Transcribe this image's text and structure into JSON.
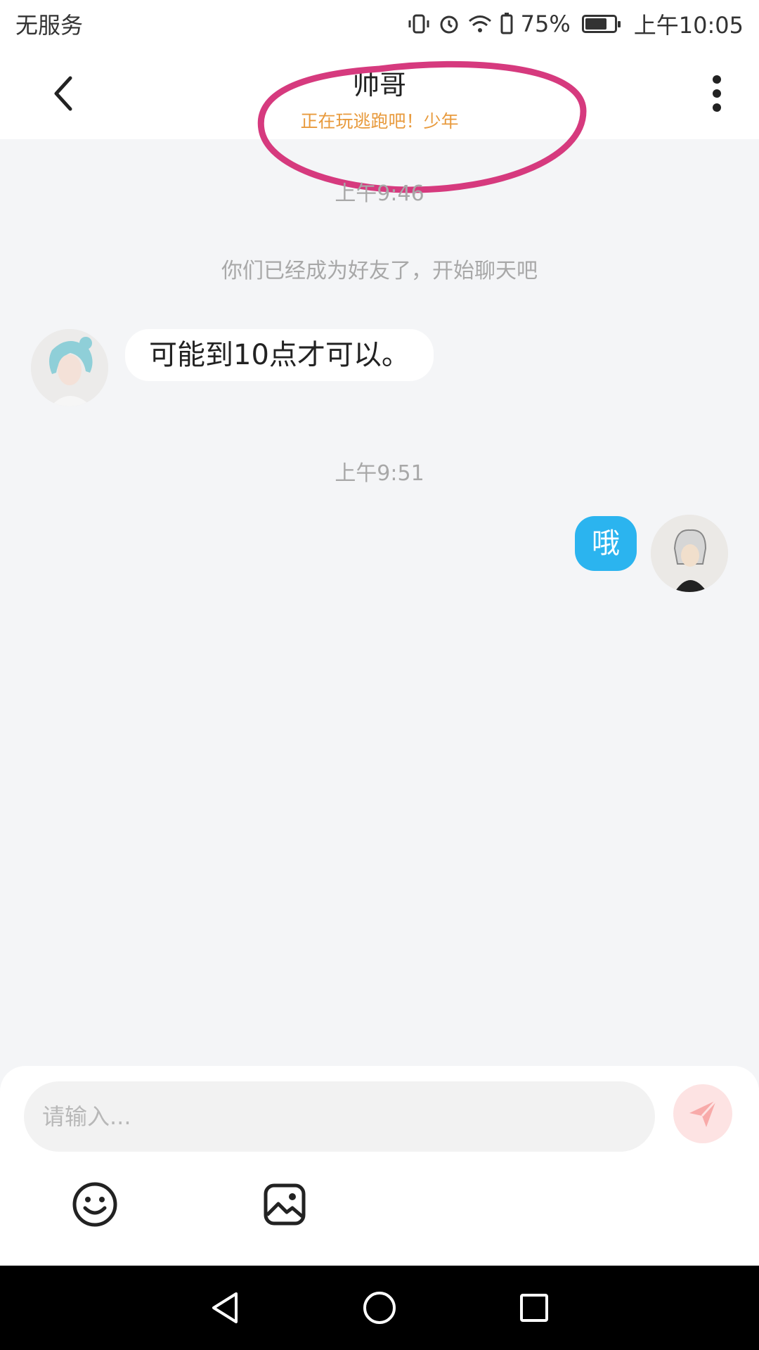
{
  "status_bar": {
    "carrier": "无服务",
    "battery_percent": "75%",
    "battery_level": 0.75,
    "time": "上午10:05",
    "icons": [
      "vibrate-icon",
      "alarm-icon",
      "wifi-icon",
      "battery-saver-icon",
      "battery-icon"
    ]
  },
  "header": {
    "title": "帅哥",
    "subtitle": "正在玩逃跑吧！少年",
    "back_icon": "chevron-left-icon",
    "more_icon": "more-vertical-icon",
    "highlight_color": "#d63a7e"
  },
  "chat": {
    "messages": [
      {
        "type": "timestamp",
        "text": "上午9:46"
      },
      {
        "type": "system",
        "text": "你们已经成为好友了，开始聊天吧"
      },
      {
        "type": "incoming",
        "text": "可能到10点才可以。"
      },
      {
        "type": "timestamp",
        "text": "上午9:51"
      },
      {
        "type": "outgoing",
        "text": "哦"
      }
    ]
  },
  "composer": {
    "placeholder": "请输入...",
    "send_icon": "send-icon",
    "send_color": "#fde3e3",
    "tools": [
      "emoji-icon",
      "image-icon"
    ]
  },
  "nav_bar": {
    "buttons": [
      "back-triangle-icon",
      "home-circle-icon",
      "recents-square-icon"
    ]
  },
  "colors": {
    "accent_blue": "#2bb4ef",
    "subtitle_orange": "#e89a3c",
    "background": "#f4f5f7"
  }
}
